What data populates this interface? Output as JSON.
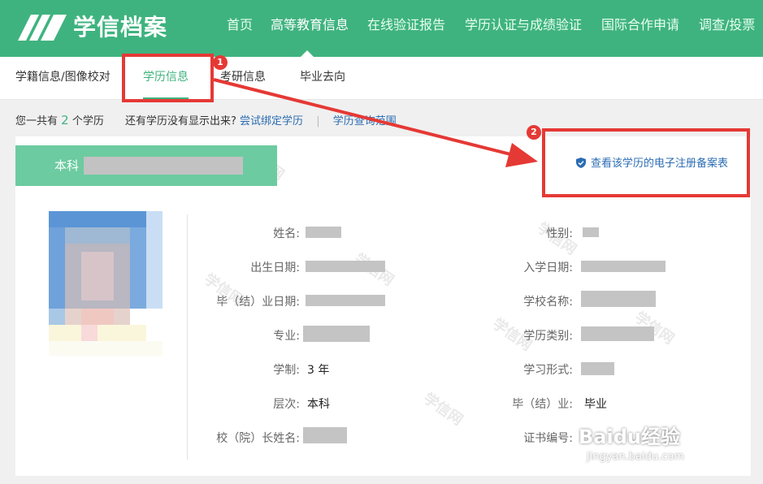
{
  "header": {
    "logo_text": "学信档案",
    "nav": [
      "首页",
      "高等教育信息",
      "在线验证报告",
      "学历认证与成绩验证",
      "国际合作申请",
      "调查/投票"
    ],
    "active_nav": "高等教育信息",
    "brand_color": "#3fb37f"
  },
  "subnav": {
    "items": [
      "学籍信息/图像校对",
      "学历信息",
      "考研信息",
      "毕业去向"
    ],
    "active": "学历信息"
  },
  "summary": {
    "prefix": "您一共有",
    "count": "2",
    "suffix": "个学历",
    "question": "还有学历没有显示出来?",
    "bind_link": "尝试绑定学历",
    "scope_link": "学历查询范围"
  },
  "record": {
    "level_tag": "本科",
    "ereg_link": "查看该学历的电子注册备案表",
    "fields_left": {
      "name_label": "姓名:",
      "birth_label": "出生日期:",
      "grad_date_label": "毕（结）业日期:",
      "major_label": "专业:",
      "duration_label": "学制:",
      "duration_value": "3 年",
      "level_label": "层次:",
      "level_value": "本科",
      "president_label": "校（院）长姓名:"
    },
    "fields_right": {
      "gender_label": "性别:",
      "enroll_label": "入学日期:",
      "school_label": "学校名称:",
      "category_label": "学历类别:",
      "form_label": "学习形式:",
      "graduation_label": "毕（结）业:",
      "graduation_value": "毕业",
      "cert_label": "证书编号:"
    }
  },
  "watermark": "学信网",
  "annotations": {
    "badge_1": "1",
    "badge_2": "2",
    "color": "#e53935"
  },
  "brand": {
    "name": "Baidu经验",
    "url": "jingyan.baidu.com"
  }
}
